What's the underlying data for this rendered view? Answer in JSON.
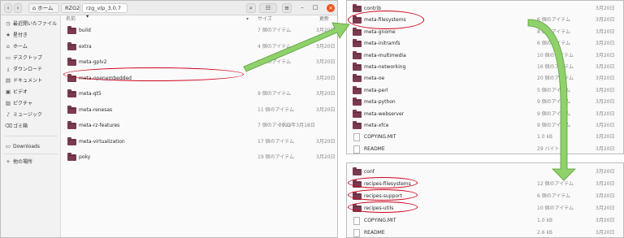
{
  "colors": {
    "accent": "#e95420",
    "folder": "#7a3b4e",
    "highlight": "#d0021b",
    "arrow": "#8fd16a"
  },
  "main": {
    "toolbar": {
      "back": "‹",
      "forward": "›",
      "home_crumb": "ホーム",
      "crumb2": "RZG2",
      "crumb3": "rzg_vlp_3.0.7",
      "crumb_dropdown": "▾",
      "search": "⌕",
      "view": "☷",
      "menu": "≡",
      "minimize": "–",
      "maximize": "□",
      "close": "×"
    },
    "sidebar": [
      {
        "icon": "clock-icon",
        "glyph": "◷",
        "label": "最近開いたファイル"
      },
      {
        "icon": "star-icon",
        "glyph": "★",
        "label": "星付き"
      },
      {
        "icon": "home-icon",
        "glyph": "⌂",
        "label": "ホーム"
      },
      {
        "icon": "desktop-icon",
        "glyph": "▭",
        "label": "デスクトップ"
      },
      {
        "icon": "download-icon",
        "glyph": "⤓",
        "label": "ダウンロード"
      },
      {
        "icon": "document-icon",
        "glyph": "▤",
        "label": "ドキュメント"
      },
      {
        "icon": "video-icon",
        "glyph": "▣",
        "label": "ビデオ"
      },
      {
        "icon": "picture-icon",
        "glyph": "▨",
        "label": "ピクチャ"
      },
      {
        "icon": "music-icon",
        "glyph": "♪",
        "label": "ミュージック"
      },
      {
        "icon": "trash-icon",
        "glyph": "⌫",
        "label": "ゴミ箱"
      },
      {
        "icon": "drive-icon",
        "glyph": "▭",
        "label": "Downloads"
      },
      {
        "icon": "plus-icon",
        "glyph": "+",
        "label": "他の場所"
      }
    ],
    "columns": {
      "name": "名前",
      "sort": "▾",
      "size": "サイズ",
      "date": "更新"
    },
    "rows": [
      {
        "name": "build",
        "size": "7 個のアイテム",
        "date": "3月20日"
      },
      {
        "name": "extra",
        "size": "4 個のアイテム",
        "date": "3月20日"
      },
      {
        "name": "meta-gplv2",
        "size": "7 個のアイテム",
        "date": "3月20日"
      },
      {
        "name": "meta-openembedded",
        "size": "",
        "date": "3月20日"
      },
      {
        "name": "meta-qt5",
        "size": "9 個のアイテム",
        "date": "3月20日"
      },
      {
        "name": "meta-renesas",
        "size": "11 個のアイテム",
        "date": "3月20日"
      },
      {
        "name": "meta-rz-features",
        "size": "7 個のアイテム",
        "date": "2023年3月18日"
      },
      {
        "name": "meta-virtualization",
        "size": "17 個のアイテム",
        "date": "3月20日"
      },
      {
        "name": "poky",
        "size": "19 個のアイテム",
        "date": "3月20日"
      }
    ]
  },
  "top_right": {
    "rows": [
      {
        "name": "contrib",
        "size": "",
        "date": "3月20日",
        "type": "folder"
      },
      {
        "name": "meta-filesystems",
        "size": "6 個のアイテム",
        "date": "3月20日",
        "type": "folder"
      },
      {
        "name": "meta-gnome",
        "size": "8 個のアイテム",
        "date": "3月20日",
        "type": "folder"
      },
      {
        "name": "meta-initramfs",
        "size": "6 個のアイテム",
        "date": "3月20日",
        "type": "folder"
      },
      {
        "name": "meta-multimedia",
        "size": "10 個のアイテム",
        "date": "3月20日",
        "type": "folder"
      },
      {
        "name": "meta-networking",
        "size": "16 個のアイテム",
        "date": "3月20日",
        "type": "folder"
      },
      {
        "name": "meta-oe",
        "size": "20 個のアイテム",
        "date": "3月20日",
        "type": "folder"
      },
      {
        "name": "meta-perl",
        "size": "5 個のアイテム",
        "date": "3月20日",
        "type": "folder"
      },
      {
        "name": "meta-python",
        "size": "9 個のアイテム",
        "date": "3月20日",
        "type": "folder"
      },
      {
        "name": "meta-webserver",
        "size": "9 個のアイテム",
        "date": "3月20日",
        "type": "folder"
      },
      {
        "name": "meta-xfce",
        "size": "9 個のアイテム",
        "date": "3月20日",
        "type": "folder"
      },
      {
        "name": "COPYING.MIT",
        "size": "1.0 kB",
        "date": "3月20日",
        "type": "file"
      },
      {
        "name": "README",
        "size": "29 バイト",
        "date": "3月20日",
        "type": "file"
      }
    ]
  },
  "bottom_right": {
    "rows": [
      {
        "name": "conf",
        "size": "",
        "date": "3月20日",
        "type": "folder"
      },
      {
        "name": "recipes-filesystems",
        "size": "12 個のアイテム",
        "date": "3月20日",
        "type": "folder"
      },
      {
        "name": "recipes-support",
        "size": "6 個のアイテム",
        "date": "3月20日",
        "type": "folder"
      },
      {
        "name": "recipes-utils",
        "size": "10 個のアイテム",
        "date": "3月20日",
        "type": "folder"
      },
      {
        "name": "COPYING.MIT",
        "size": "1.0 kB",
        "date": "3月20日",
        "type": "file"
      },
      {
        "name": "README",
        "size": "2.6 kB",
        "date": "3月20日",
        "type": "file"
      }
    ]
  }
}
